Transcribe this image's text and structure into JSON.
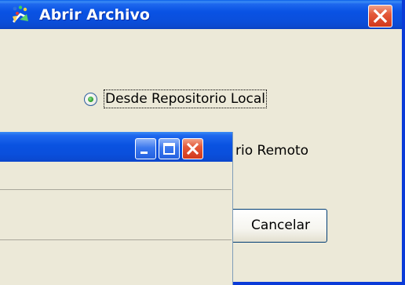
{
  "dialog": {
    "title": "Abrir Archivo",
    "options": [
      {
        "label": "Desde Repositorio Local",
        "selected": true
      },
      {
        "label": "Desde Repositorio Remoto",
        "selected": false
      }
    ],
    "visible_remote_label_fragment": "rio Remoto",
    "cancel_label": "Cancelar",
    "icons": {
      "app": "app-icon",
      "close": "close-icon"
    }
  },
  "front_window": {
    "icons": {
      "minimize": "minimize-icon",
      "maximize": "maximize-icon",
      "close": "close-icon"
    }
  },
  "colors": {
    "titlebar_blue": "#0a52e0",
    "close_red": "#e4593a",
    "window_face": "#ece9d8"
  }
}
